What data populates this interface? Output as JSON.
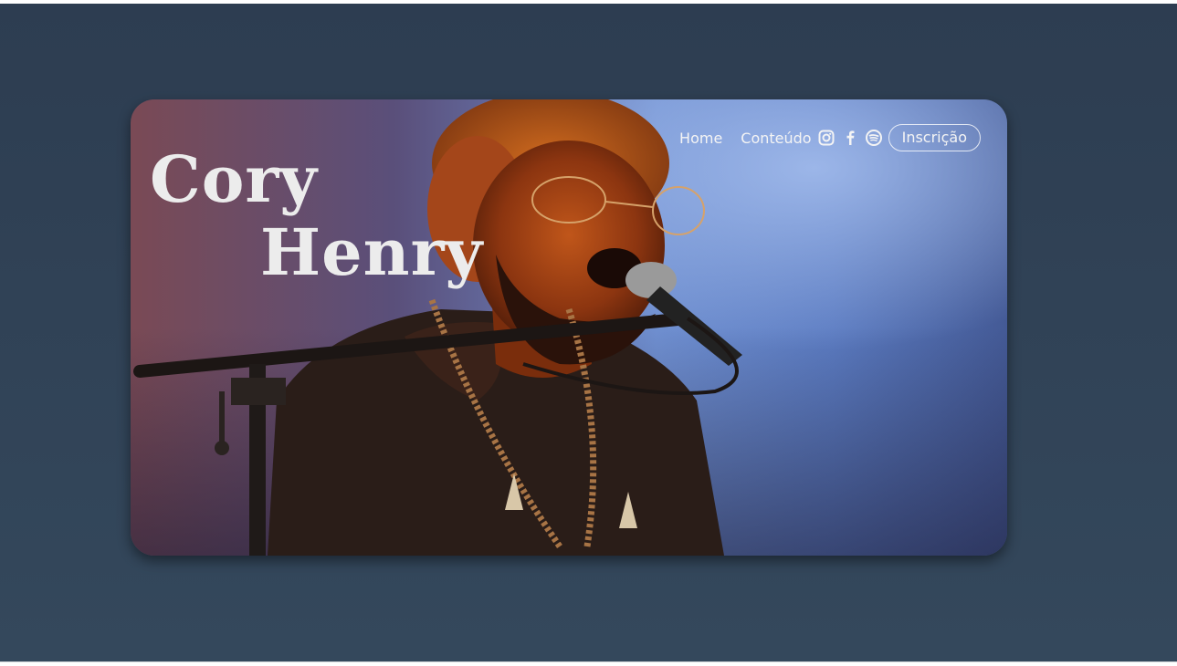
{
  "hero": {
    "title_line1": "Cory",
    "title_line2": "Henry",
    "photo_icon": "singer-with-microphone-photo"
  },
  "nav": {
    "home": "Home",
    "content": "Conteúdo",
    "social": [
      {
        "icon": "instagram-icon"
      },
      {
        "icon": "facebook-icon"
      },
      {
        "icon": "spotify-icon"
      }
    ],
    "signup": "Inscrição"
  },
  "colors": {
    "page_background": "#2f3f53",
    "text": "#f4f4f4"
  }
}
